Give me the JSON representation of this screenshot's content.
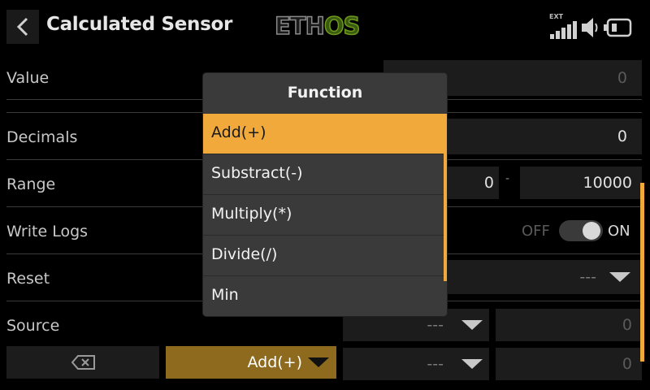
{
  "header": {
    "title": "Calculated Sensor",
    "logo_eth": "ETH",
    "logo_os": "OS",
    "ext_label": "EXT"
  },
  "rows": {
    "value_label": "Value",
    "value": "0",
    "decimals_label": "Decimals",
    "decimals": "0",
    "range_label": "Range",
    "range_min": "0",
    "range_sep": "-",
    "range_max": "10000",
    "write_logs_label": "Write Logs",
    "write_logs_off": "OFF",
    "write_logs_on": "ON",
    "write_logs_state": "ON",
    "reset_label": "Reset",
    "reset_value": "---",
    "source_label": "Source",
    "source1_value": "---",
    "source1_number": "0",
    "source2_value": "---",
    "source2_number": "0",
    "function_button": "Add(+)"
  },
  "modal": {
    "title": "Function",
    "items": [
      "Add(+)",
      "Substract(-)",
      "Multiply(*)",
      "Divide(/)",
      "Min"
    ],
    "selected": "Add(+)"
  },
  "colors": {
    "accent": "#f0a93a",
    "accent_dark": "#8e6a1e",
    "field_bg": "#1c1c1c",
    "modal_bg": "#3a3a3a"
  },
  "icons": [
    "back-arrow-icon",
    "signal-bars-icon",
    "speaker-icon",
    "battery-icon",
    "clear-icon",
    "dropdown-arrow-icon"
  ]
}
